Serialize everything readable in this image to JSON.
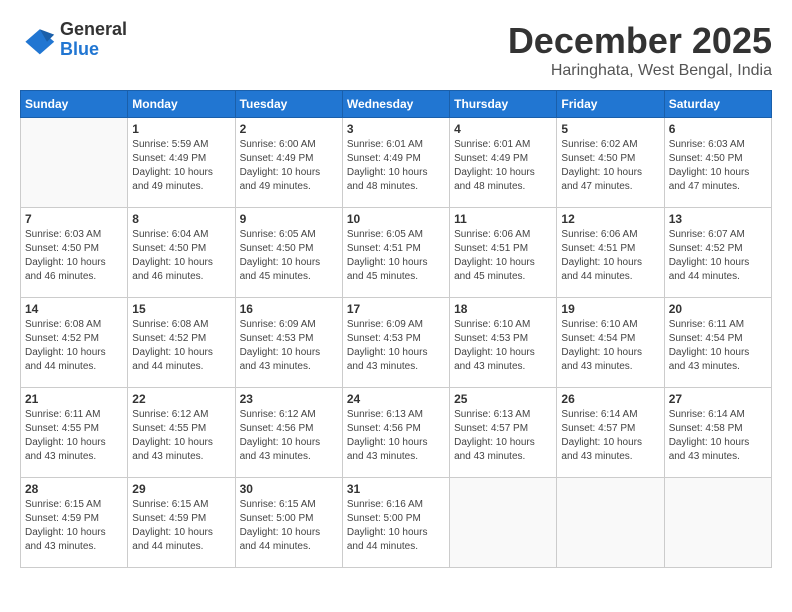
{
  "header": {
    "logo_general": "General",
    "logo_blue": "Blue",
    "month_title": "December 2025",
    "location": "Haringhata, West Bengal, India"
  },
  "days_of_week": [
    "Sunday",
    "Monday",
    "Tuesday",
    "Wednesday",
    "Thursday",
    "Friday",
    "Saturday"
  ],
  "weeks": [
    [
      {
        "day": "",
        "sunrise": "",
        "sunset": "",
        "daylight": ""
      },
      {
        "day": "1",
        "sunrise": "Sunrise: 5:59 AM",
        "sunset": "Sunset: 4:49 PM",
        "daylight": "Daylight: 10 hours and 49 minutes."
      },
      {
        "day": "2",
        "sunrise": "Sunrise: 6:00 AM",
        "sunset": "Sunset: 4:49 PM",
        "daylight": "Daylight: 10 hours and 49 minutes."
      },
      {
        "day": "3",
        "sunrise": "Sunrise: 6:01 AM",
        "sunset": "Sunset: 4:49 PM",
        "daylight": "Daylight: 10 hours and 48 minutes."
      },
      {
        "day": "4",
        "sunrise": "Sunrise: 6:01 AM",
        "sunset": "Sunset: 4:49 PM",
        "daylight": "Daylight: 10 hours and 48 minutes."
      },
      {
        "day": "5",
        "sunrise": "Sunrise: 6:02 AM",
        "sunset": "Sunset: 4:50 PM",
        "daylight": "Daylight: 10 hours and 47 minutes."
      },
      {
        "day": "6",
        "sunrise": "Sunrise: 6:03 AM",
        "sunset": "Sunset: 4:50 PM",
        "daylight": "Daylight: 10 hours and 47 minutes."
      }
    ],
    [
      {
        "day": "7",
        "sunrise": "Sunrise: 6:03 AM",
        "sunset": "Sunset: 4:50 PM",
        "daylight": "Daylight: 10 hours and 46 minutes."
      },
      {
        "day": "8",
        "sunrise": "Sunrise: 6:04 AM",
        "sunset": "Sunset: 4:50 PM",
        "daylight": "Daylight: 10 hours and 46 minutes."
      },
      {
        "day": "9",
        "sunrise": "Sunrise: 6:05 AM",
        "sunset": "Sunset: 4:50 PM",
        "daylight": "Daylight: 10 hours and 45 minutes."
      },
      {
        "day": "10",
        "sunrise": "Sunrise: 6:05 AM",
        "sunset": "Sunset: 4:51 PM",
        "daylight": "Daylight: 10 hours and 45 minutes."
      },
      {
        "day": "11",
        "sunrise": "Sunrise: 6:06 AM",
        "sunset": "Sunset: 4:51 PM",
        "daylight": "Daylight: 10 hours and 45 minutes."
      },
      {
        "day": "12",
        "sunrise": "Sunrise: 6:06 AM",
        "sunset": "Sunset: 4:51 PM",
        "daylight": "Daylight: 10 hours and 44 minutes."
      },
      {
        "day": "13",
        "sunrise": "Sunrise: 6:07 AM",
        "sunset": "Sunset: 4:52 PM",
        "daylight": "Daylight: 10 hours and 44 minutes."
      }
    ],
    [
      {
        "day": "14",
        "sunrise": "Sunrise: 6:08 AM",
        "sunset": "Sunset: 4:52 PM",
        "daylight": "Daylight: 10 hours and 44 minutes."
      },
      {
        "day": "15",
        "sunrise": "Sunrise: 6:08 AM",
        "sunset": "Sunset: 4:52 PM",
        "daylight": "Daylight: 10 hours and 44 minutes."
      },
      {
        "day": "16",
        "sunrise": "Sunrise: 6:09 AM",
        "sunset": "Sunset: 4:53 PM",
        "daylight": "Daylight: 10 hours and 43 minutes."
      },
      {
        "day": "17",
        "sunrise": "Sunrise: 6:09 AM",
        "sunset": "Sunset: 4:53 PM",
        "daylight": "Daylight: 10 hours and 43 minutes."
      },
      {
        "day": "18",
        "sunrise": "Sunrise: 6:10 AM",
        "sunset": "Sunset: 4:53 PM",
        "daylight": "Daylight: 10 hours and 43 minutes."
      },
      {
        "day": "19",
        "sunrise": "Sunrise: 6:10 AM",
        "sunset": "Sunset: 4:54 PM",
        "daylight": "Daylight: 10 hours and 43 minutes."
      },
      {
        "day": "20",
        "sunrise": "Sunrise: 6:11 AM",
        "sunset": "Sunset: 4:54 PM",
        "daylight": "Daylight: 10 hours and 43 minutes."
      }
    ],
    [
      {
        "day": "21",
        "sunrise": "Sunrise: 6:11 AM",
        "sunset": "Sunset: 4:55 PM",
        "daylight": "Daylight: 10 hours and 43 minutes."
      },
      {
        "day": "22",
        "sunrise": "Sunrise: 6:12 AM",
        "sunset": "Sunset: 4:55 PM",
        "daylight": "Daylight: 10 hours and 43 minutes."
      },
      {
        "day": "23",
        "sunrise": "Sunrise: 6:12 AM",
        "sunset": "Sunset: 4:56 PM",
        "daylight": "Daylight: 10 hours and 43 minutes."
      },
      {
        "day": "24",
        "sunrise": "Sunrise: 6:13 AM",
        "sunset": "Sunset: 4:56 PM",
        "daylight": "Daylight: 10 hours and 43 minutes."
      },
      {
        "day": "25",
        "sunrise": "Sunrise: 6:13 AM",
        "sunset": "Sunset: 4:57 PM",
        "daylight": "Daylight: 10 hours and 43 minutes."
      },
      {
        "day": "26",
        "sunrise": "Sunrise: 6:14 AM",
        "sunset": "Sunset: 4:57 PM",
        "daylight": "Daylight: 10 hours and 43 minutes."
      },
      {
        "day": "27",
        "sunrise": "Sunrise: 6:14 AM",
        "sunset": "Sunset: 4:58 PM",
        "daylight": "Daylight: 10 hours and 43 minutes."
      }
    ],
    [
      {
        "day": "28",
        "sunrise": "Sunrise: 6:15 AM",
        "sunset": "Sunset: 4:59 PM",
        "daylight": "Daylight: 10 hours and 43 minutes."
      },
      {
        "day": "29",
        "sunrise": "Sunrise: 6:15 AM",
        "sunset": "Sunset: 4:59 PM",
        "daylight": "Daylight: 10 hours and 44 minutes."
      },
      {
        "day": "30",
        "sunrise": "Sunrise: 6:15 AM",
        "sunset": "Sunset: 5:00 PM",
        "daylight": "Daylight: 10 hours and 44 minutes."
      },
      {
        "day": "31",
        "sunrise": "Sunrise: 6:16 AM",
        "sunset": "Sunset: 5:00 PM",
        "daylight": "Daylight: 10 hours and 44 minutes."
      },
      {
        "day": "",
        "sunrise": "",
        "sunset": "",
        "daylight": ""
      },
      {
        "day": "",
        "sunrise": "",
        "sunset": "",
        "daylight": ""
      },
      {
        "day": "",
        "sunrise": "",
        "sunset": "",
        "daylight": ""
      }
    ]
  ]
}
